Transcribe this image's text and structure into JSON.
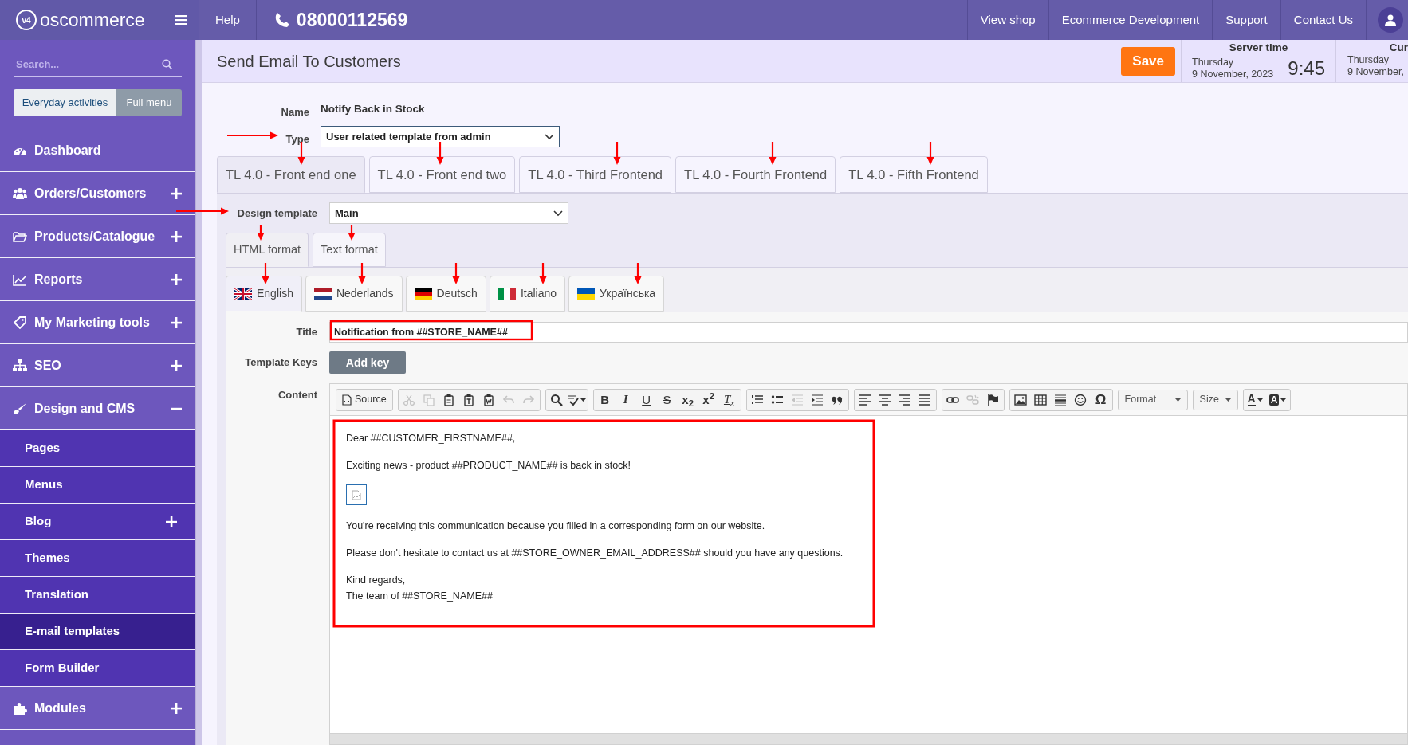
{
  "topbar": {
    "logo_badge": "v4",
    "logo_text": "oscommerce",
    "help": "Help",
    "phone": "08000112569",
    "links": [
      "View shop",
      "Ecommerce Development",
      "Support",
      "Contact Us"
    ]
  },
  "sidebar": {
    "search": {
      "placeholder": "Search..."
    },
    "mode_buttons": [
      {
        "label": "Everyday activities",
        "selected": false
      },
      {
        "label": "Full menu",
        "selected": true
      }
    ],
    "items": [
      {
        "label": "Dashboard",
        "kind": "link"
      },
      {
        "label": "Orders/Customers",
        "kind": "group",
        "expanded": false
      },
      {
        "label": "Products/Catalogue",
        "kind": "group",
        "expanded": false
      },
      {
        "label": "Reports",
        "kind": "group",
        "expanded": false
      },
      {
        "label": "My Marketing tools",
        "kind": "group",
        "expanded": false
      },
      {
        "label": "SEO",
        "kind": "group",
        "expanded": false
      },
      {
        "label": "Design and CMS",
        "kind": "group",
        "expanded": true,
        "children": [
          {
            "label": "Pages",
            "kind": "link",
            "selected": false
          },
          {
            "label": "Menus",
            "kind": "link",
            "selected": false
          },
          {
            "label": "Blog",
            "kind": "group",
            "expanded": false,
            "selected": false
          },
          {
            "label": "Themes",
            "kind": "link",
            "selected": false
          },
          {
            "label": "Translation",
            "kind": "link",
            "selected": false
          },
          {
            "label": "E-mail templates",
            "kind": "link",
            "selected": true
          },
          {
            "label": "Form Builder",
            "kind": "link",
            "selected": false
          }
        ]
      },
      {
        "label": "Modules",
        "kind": "group",
        "expanded": false
      }
    ]
  },
  "header": {
    "title": "Send Email To Customers",
    "save": "Save",
    "server_time": {
      "label": "Server time",
      "day": "Thursday",
      "date": "9 November, 2023",
      "time": "9:45"
    },
    "current_time": {
      "label": "Cur",
      "day": "Thursday",
      "date": "9 November,"
    }
  },
  "form": {
    "name": {
      "label": "Name",
      "value": "Notify Back in Stock"
    },
    "type": {
      "label": "Type",
      "value": "User related template from admin"
    },
    "frontend_tabs": [
      {
        "label": "TL 4.0 - Front end one",
        "selected": true
      },
      {
        "label": "TL 4.0 - Front end two",
        "selected": false
      },
      {
        "label": "TL 4.0 - Third Frontend",
        "selected": false
      },
      {
        "label": "TL 4.0 - Fourth Frontend",
        "selected": false
      },
      {
        "label": "TL 4.0 - Fifth Frontend",
        "selected": false
      }
    ],
    "design_template": {
      "label": "Design template",
      "value": "Main"
    },
    "format_tabs": [
      {
        "label": "HTML format",
        "selected": true
      },
      {
        "label": "Text format",
        "selected": false
      }
    ],
    "language_tabs": [
      {
        "label": "English",
        "selected": true
      },
      {
        "label": "Nederlands",
        "selected": false
      },
      {
        "label": "Deutsch",
        "selected": false
      },
      {
        "label": "Italiano",
        "selected": false
      },
      {
        "label": "Українська",
        "selected": false
      }
    ],
    "title": {
      "label": "Title",
      "value": "Notification from ##STORE_NAME##"
    },
    "template_keys": {
      "label": "Template Keys",
      "button": "Add key"
    },
    "content": {
      "label": "Content",
      "toolbar": [
        [
          {
            "kind": "source",
            "text": "Source",
            "disabled": false
          }
        ],
        [
          {
            "kind": "icon",
            "disabled": true
          },
          {
            "kind": "icon",
            "disabled": true
          },
          {
            "kind": "icon",
            "disabled": false
          },
          {
            "kind": "icon",
            "disabled": false
          },
          {
            "kind": "icon",
            "disabled": false
          },
          {
            "kind": "icon",
            "disabled": true
          },
          {
            "kind": "icon",
            "disabled": true
          }
        ],
        [
          {
            "kind": "icon",
            "disabled": false
          },
          {
            "kind": "icon",
            "disabled": false
          }
        ],
        [
          {
            "kind": "glyph",
            "text": "B",
            "disabled": false
          },
          {
            "kind": "glyph",
            "text": "I",
            "disabled": false
          },
          {
            "kind": "glyph",
            "text": "U",
            "disabled": false
          },
          {
            "kind": "glyph",
            "text": "S",
            "disabled": false
          },
          {
            "kind": "glyph",
            "text": "x$_{2}$",
            "disabled": false
          },
          {
            "kind": "glyph",
            "text": "x$^{2}$",
            "disabled": false
          },
          {
            "kind": "glyph",
            "text": "T$_{x}$",
            "disabled": false
          }
        ],
        [
          {
            "kind": "icon",
            "disabled": false
          },
          {
            "kind": "icon",
            "disabled": false
          },
          {
            "kind": "icon",
            "disabled": true
          },
          {
            "kind": "icon",
            "disabled": false
          },
          {
            "kind": "icon",
            "disabled": false
          }
        ],
        [
          {
            "kind": "icon",
            "disabled": false
          },
          {
            "kind": "icon",
            "disabled": false
          },
          {
            "kind": "icon",
            "disabled": false
          },
          {
            "kind": "icon",
            "disabled": false
          }
        ],
        [
          {
            "kind": "icon",
            "disabled": false
          },
          {
            "kind": "icon",
            "disabled": true
          },
          {
            "kind": "icon",
            "disabled": false
          }
        ],
        [
          {
            "kind": "icon",
            "disabled": false
          },
          {
            "kind": "icon",
            "disabled": false
          },
          {
            "kind": "icon",
            "disabled": false
          },
          {
            "kind": "icon",
            "disabled": false
          },
          {
            "kind": "glyph",
            "text": "Ω",
            "disabled": false
          }
        ],
        [
          {
            "kind": "dropdown",
            "text": "Format",
            "disabled": false
          }
        ],
        [
          {
            "kind": "dropdown",
            "text": "Size",
            "disabled": false
          }
        ],
        [
          {
            "kind": "text-color",
            "text": "A",
            "disabled": false
          },
          {
            "kind": "bg-color",
            "text": "A",
            "disabled": false
          }
        ]
      ],
      "body": [
        {
          "kind": "text",
          "lines": [
            "Dear ##CUSTOMER_FIRSTNAME##,"
          ]
        },
        {
          "kind": "text",
          "lines": [
            "Exciting news - product ##PRODUCT_NAME## is back in stock!"
          ]
        },
        {
          "kind": "image"
        },
        {
          "kind": "text",
          "lines": [
            "You're receiving this communication because you filled in a corresponding form on our website."
          ]
        },
        {
          "kind": "text",
          "lines": [
            "Please don't hesitate to contact us at ##STORE_OWNER_EMAIL_ADDRESS## should you have any questions."
          ]
        },
        {
          "kind": "text",
          "lines": [
            "Kind regards,",
            "The team of ##STORE_NAME##"
          ]
        }
      ]
    }
  }
}
